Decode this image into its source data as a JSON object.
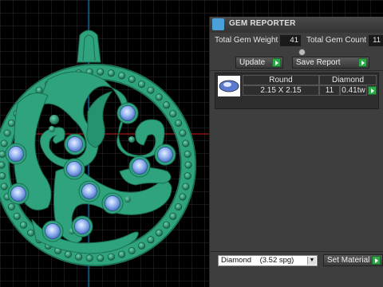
{
  "panel": {
    "title": "GEM REPORTER",
    "icon": "gem-reporter-icon"
  },
  "stats": {
    "total_weight_label": "Total Gem Weight",
    "total_weight_value": "41",
    "total_count_label": "Total Gem Count",
    "total_count_value": "11"
  },
  "actions": {
    "update_label": "Update",
    "save_report_label": "Save Report"
  },
  "report_table": {
    "headers": [
      "Round",
      "Diamond"
    ],
    "size": "2.15 X 2.15",
    "count": "11",
    "weight": "0.41tw"
  },
  "material": {
    "selected": "Diamond    (3.52 spg)",
    "set_label": "Set Material"
  },
  "colors": {
    "background": "#000000",
    "grid": "#3a3a3a",
    "pendant": "#2fa37e",
    "pendant_dark": "#1e7c5d",
    "gem": "#8fb0ee",
    "accent_green": "#2fa84a",
    "axis_red": "#c81c1c",
    "axis_blue": "#1a8ed8"
  }
}
